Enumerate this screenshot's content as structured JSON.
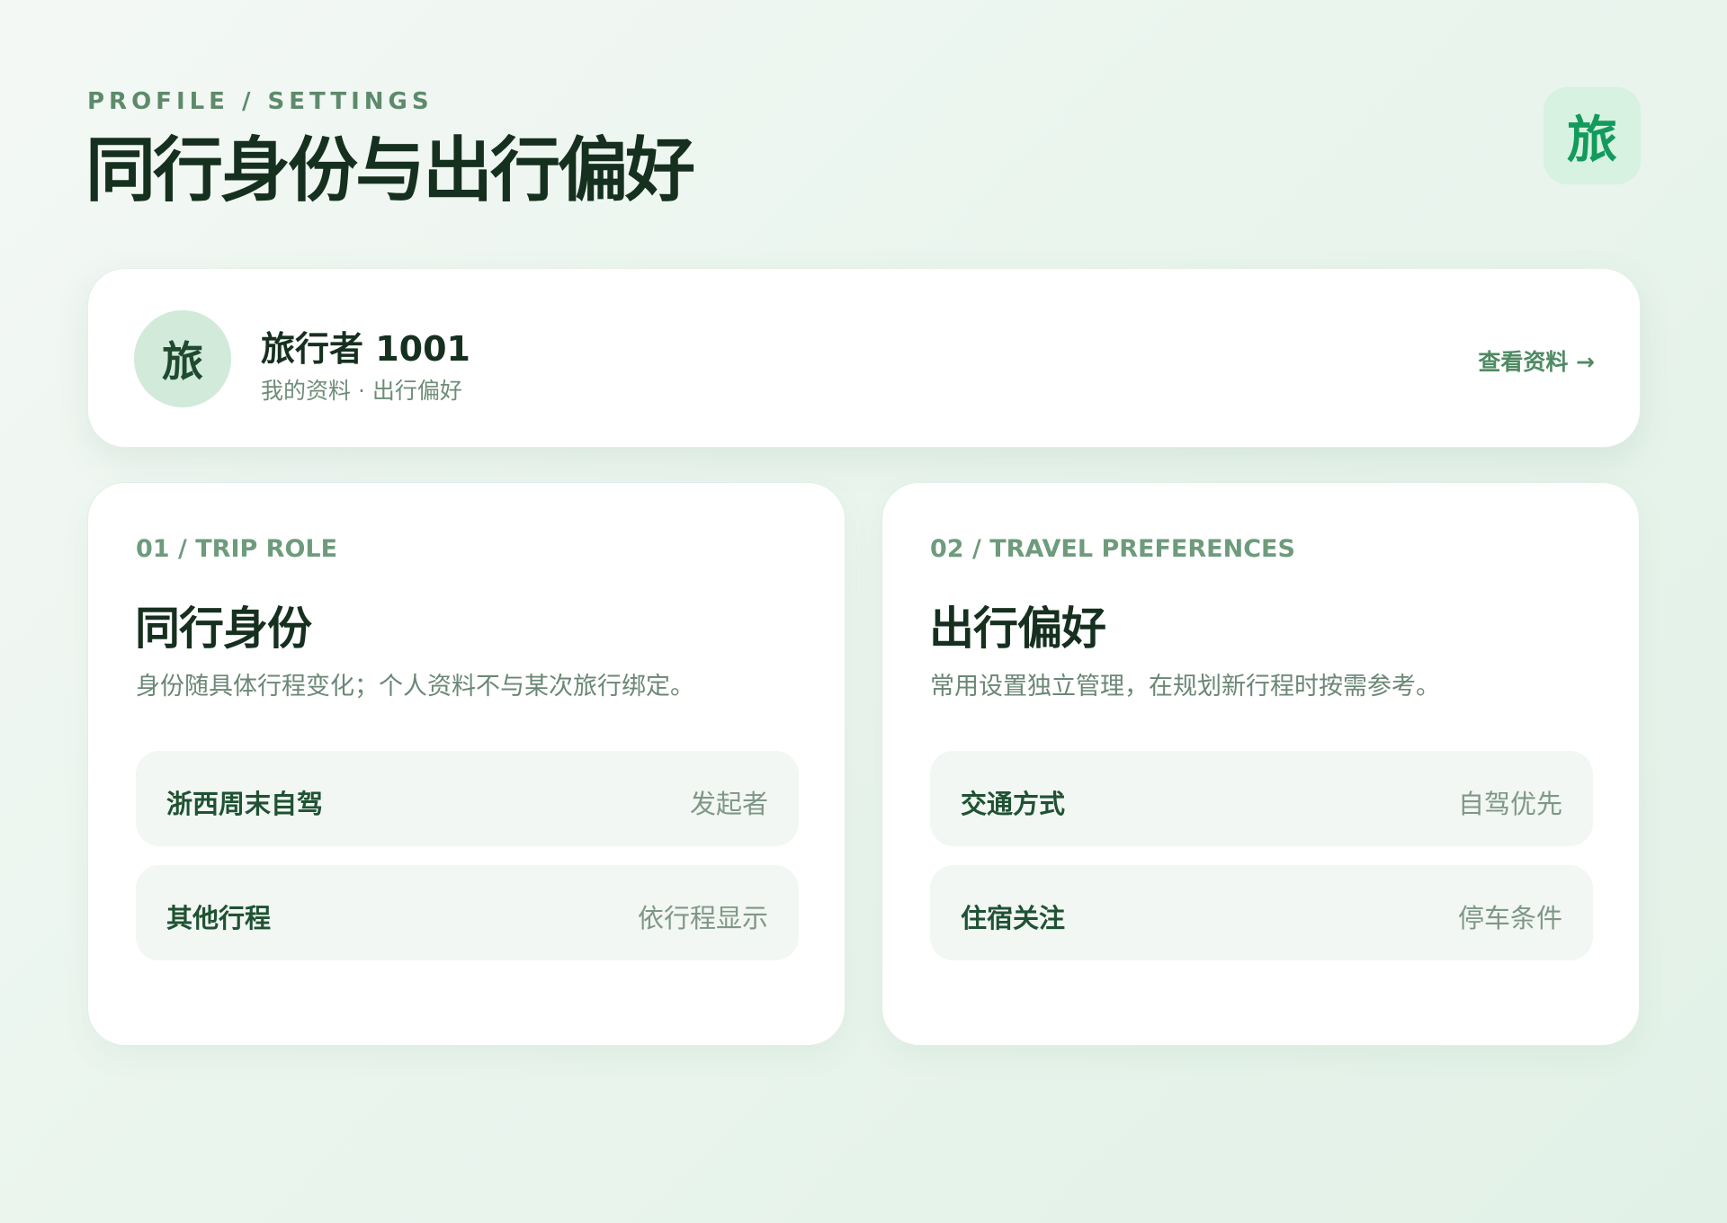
{
  "header": {
    "breadcrumb": "PROFILE / SETTINGS",
    "title": "同行身份与出行偏好",
    "brand_glyph": "旅"
  },
  "profile": {
    "avatar_glyph": "旅",
    "name": "旅行者 1001",
    "subtitle": "我的资料 · 出行偏好",
    "view_link": "查看资料 →"
  },
  "sections": [
    {
      "eyebrow": "01 / TRIP ROLE",
      "title": "同行身份",
      "description": "身份随具体行程变化；个人资料不与某次旅行绑定。",
      "rows": [
        {
          "label": "浙西周末自驾",
          "value": "发起者"
        },
        {
          "label": "其他行程",
          "value": "依行程显示"
        }
      ]
    },
    {
      "eyebrow": "02 / TRAVEL PREFERENCES",
      "title": "出行偏好",
      "description": "常用设置独立管理，在规划新行程时按需参考。",
      "rows": [
        {
          "label": "交通方式",
          "value": "自驾优先"
        },
        {
          "label": "住宿关注",
          "value": "停车条件"
        }
      ]
    }
  ],
  "colors": {
    "accent": "#139a5d",
    "title_text": "#16301f",
    "muted_text": "#6b8775",
    "row_background": "#f2f7f3"
  }
}
